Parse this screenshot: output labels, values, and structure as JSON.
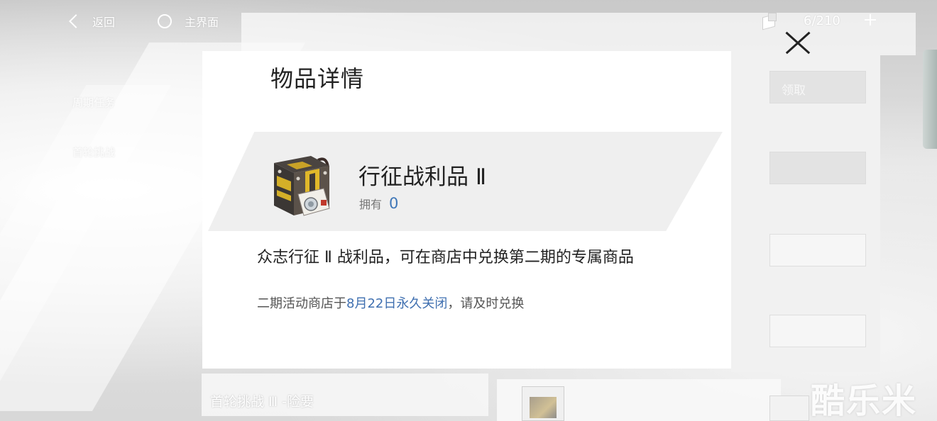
{
  "topbar": {
    "back_label": "返回",
    "home_label": "主界面",
    "resource_count": "6/210"
  },
  "background": {
    "side_labels": [
      "周期任务",
      "首轮挑战"
    ],
    "claim_button": "领取",
    "bottom_card_title": "首轮挑战 Ⅲ -险要"
  },
  "modal": {
    "title": "物品详情",
    "item": {
      "name": "行征战利品 Ⅱ",
      "owned_label": "拥有",
      "owned_value": "0",
      "icon": "loot-crate-icon"
    },
    "description": "众志行征 Ⅱ 战利品，可在商店中兑换第二期的专属商品",
    "notice_prefix": "二期活动商店于",
    "notice_highlight": "8月22日永久关闭",
    "notice_suffix": "，请及时兑换"
  },
  "watermark": "酷乐米"
}
